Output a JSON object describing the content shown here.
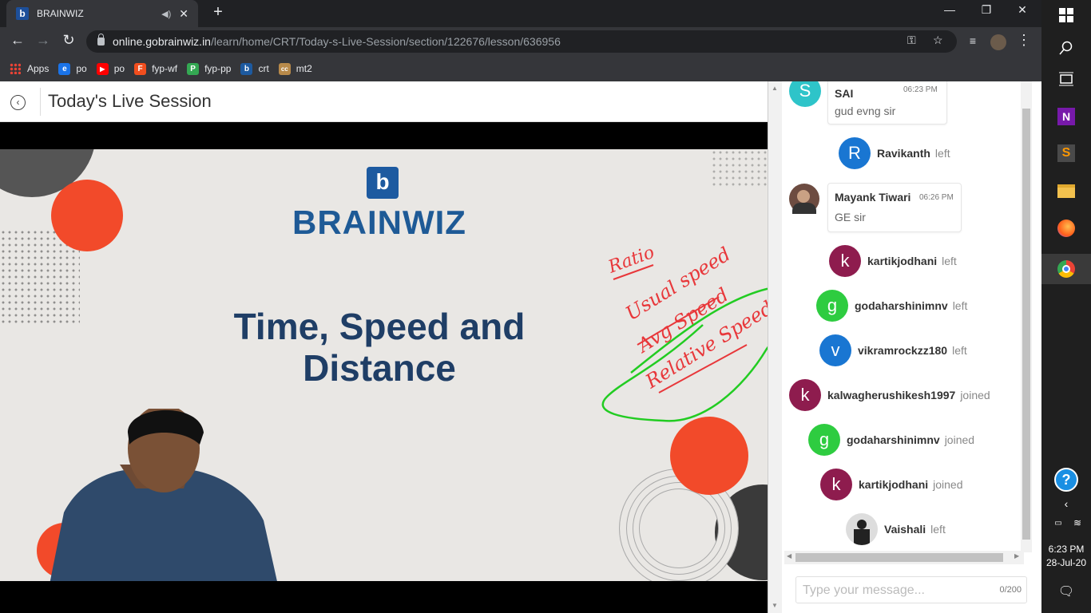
{
  "browser": {
    "tab_title": "BRAINWIZ",
    "url_host": "online.gobrainwiz.in",
    "url_path": "/learn/home/CRT/Today-s-Live-Session/section/122676/lesson/636956",
    "bookmarks": [
      {
        "label": "Apps"
      },
      {
        "label": "po",
        "color": "#1a73e8",
        "glyph": "e"
      },
      {
        "label": "po",
        "color": "#ff0000",
        "glyph": "▶"
      },
      {
        "label": "fyp-wf",
        "color": "#f24e1e",
        "glyph": "F"
      },
      {
        "label": "fyp-pp",
        "color": "#34a853",
        "glyph": "P"
      },
      {
        "label": "crt",
        "color": "#1d5aa0",
        "glyph": "b"
      },
      {
        "label": "mt2",
        "color": "#b88a4a",
        "glyph": "cc"
      }
    ]
  },
  "page": {
    "title": "Today's Live Session"
  },
  "slide": {
    "brand": "BRAINWIZ",
    "title_line1": "Time, Speed and",
    "title_line2": "Distance",
    "ink_notes": [
      "Ratio",
      "Usual speed",
      "Avg Speed",
      "Relative Speed"
    ]
  },
  "chat": {
    "messages": [
      {
        "type": "message",
        "initial": "S",
        "color": "#2ec4c9",
        "name": "SAI",
        "time": "06:23 PM",
        "text": "gud evng sir"
      },
      {
        "type": "event",
        "initial": "R",
        "color": "#1976d2",
        "name": "Ravikanth",
        "status": "left"
      },
      {
        "type": "message",
        "initial": "",
        "color": "#6d4c41",
        "name": "Mayank Tiwari",
        "time": "06:26 PM",
        "text": "GE sir"
      },
      {
        "type": "event",
        "initial": "k",
        "color": "#8e1c4e",
        "name": "kartikjodhani",
        "status": "left"
      },
      {
        "type": "event",
        "initial": "g",
        "color": "#2ecc40",
        "name": "godaharshinimnv",
        "status": "left"
      },
      {
        "type": "event",
        "initial": "v",
        "color": "#1976d2",
        "name": "vikramrockzz180",
        "status": "left"
      },
      {
        "type": "event",
        "initial": "k",
        "color": "#8e1c4e",
        "name": "kalwagherushikesh1997",
        "status": "joined"
      },
      {
        "type": "event",
        "initial": "g",
        "color": "#2ecc40",
        "name": "godaharshinimnv",
        "status": "joined"
      },
      {
        "type": "event",
        "initial": "k",
        "color": "#8e1c4e",
        "name": "kartikjodhani",
        "status": "joined"
      },
      {
        "type": "event",
        "initial": "",
        "color": "#999999",
        "name": "Vaishali",
        "status": "left"
      }
    ],
    "input_placeholder": "Type your message...",
    "counter": "0/200"
  },
  "taskbar": {
    "time": "6:23 PM",
    "date": "28-Jul-20"
  }
}
